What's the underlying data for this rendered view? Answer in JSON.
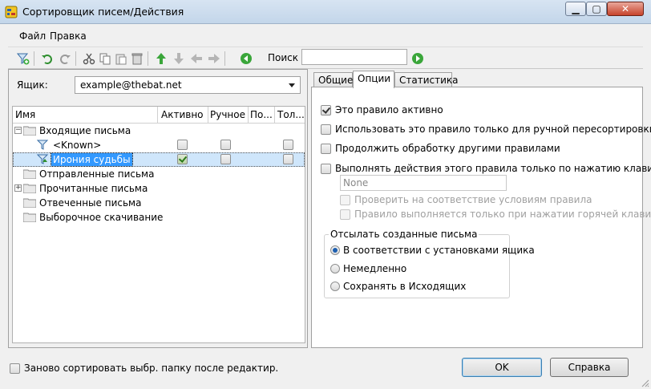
{
  "window": {
    "title": "Сортировщик писем/Действия",
    "minimize_icon": "minimize-icon",
    "maximize_icon": "maximize-icon",
    "close_icon": "close-icon"
  },
  "menu": {
    "file": "Файл",
    "edit": "Правка"
  },
  "toolbar": {
    "search_label": "Поиск",
    "search_value": ""
  },
  "mailbox": {
    "label": "Ящик:",
    "selected": "example@thebat.net"
  },
  "tree": {
    "columns": [
      "Имя",
      "Активно",
      "Ручное",
      "По...",
      "Тол..."
    ],
    "rows": [
      {
        "label": "Входящие письма",
        "level": 0,
        "expander": "−",
        "kind": "folder"
      },
      {
        "label": "<Known>",
        "level": 1,
        "kind": "filter",
        "active": false,
        "manual": false,
        "only": false
      },
      {
        "label": "Ирония судьбы",
        "level": 1,
        "kind": "filter-selected",
        "active": true,
        "manual": false,
        "only": false,
        "selected": true
      },
      {
        "label": "Отправленные письма",
        "level": 0,
        "kind": "folder"
      },
      {
        "label": "Прочитанные письма",
        "level": 0,
        "expander": "+",
        "kind": "folder"
      },
      {
        "label": "Отвеченные письма",
        "level": 0,
        "kind": "folder"
      },
      {
        "label": "Выборочное скачивание",
        "level": 0,
        "kind": "folder"
      }
    ]
  },
  "tabs": [
    {
      "label": "Общие",
      "active": false
    },
    {
      "label": "Опции",
      "active": true
    },
    {
      "label": "Статистика",
      "active": false
    }
  ],
  "options": {
    "rule_active": "Это правило активно",
    "manual_only": "Использовать это правило только для ручной пересортировки",
    "continue": "Продолжить обработку другими правилами",
    "hotkey_only": "Выполнять действия этого правила только по нажатию клавиши",
    "hotkey_value": "None",
    "check_conditions": "Проверить на соответствие условиям правила",
    "hotkey_rule": "Правило выполняется только при нажатии горячей клавиши",
    "rule_active_checked": true
  },
  "send_group": {
    "title": "Отсылать созданные письма",
    "by_mailbox": "В соответствии с установками ящика",
    "immediately": "Немедленно",
    "save_outbox": "Сохранять в Исходящих",
    "selected": "by_mailbox"
  },
  "footer": {
    "resort_label": "Заново сортировать выбр. папку после редактир.",
    "ok": "OK",
    "help": "Справка"
  }
}
